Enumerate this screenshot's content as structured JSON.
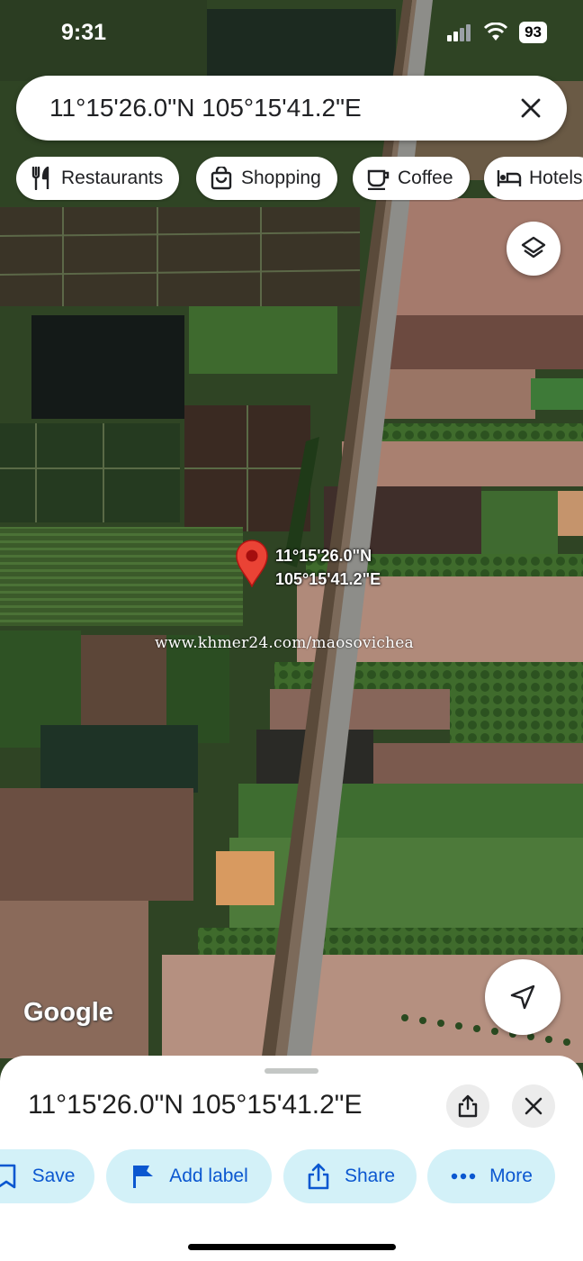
{
  "status_bar": {
    "time": "9:31",
    "battery": "93",
    "icons": [
      "signal-icon",
      "wifi-icon",
      "battery-icon"
    ]
  },
  "search": {
    "query": "11°15'26.0\"N 105°15'41.2\"E",
    "close_icon": "close-icon"
  },
  "chips": [
    {
      "label": "Restaurants",
      "icon": "fork-knife-icon"
    },
    {
      "label": "Shopping",
      "icon": "shopping-bag-icon"
    },
    {
      "label": "Coffee",
      "icon": "coffee-cup-icon"
    },
    {
      "label": "Hotels",
      "icon": "bed-icon"
    }
  ],
  "map": {
    "type": "satellite",
    "pin_label_line1": "11°15'26.0\"N",
    "pin_label_line2": "105°15'41.2\"E",
    "watermark": "www.khmer24.com/maosovichea",
    "attribution": "Google",
    "pin_color": "#ea4335"
  },
  "sheet": {
    "title": "11°15'26.0\"N 105°15'41.2\"E",
    "actions": [
      {
        "label": "Save",
        "icon": "bookmark-icon"
      },
      {
        "label": "Add label",
        "icon": "flag-icon"
      },
      {
        "label": "Share",
        "icon": "share-icon"
      },
      {
        "label": "More",
        "icon": "more-dots-icon"
      }
    ]
  },
  "colors": {
    "accent": "#0b57d0",
    "chip_bg": "#ffffff",
    "action_bg": "#d3f1f8"
  }
}
